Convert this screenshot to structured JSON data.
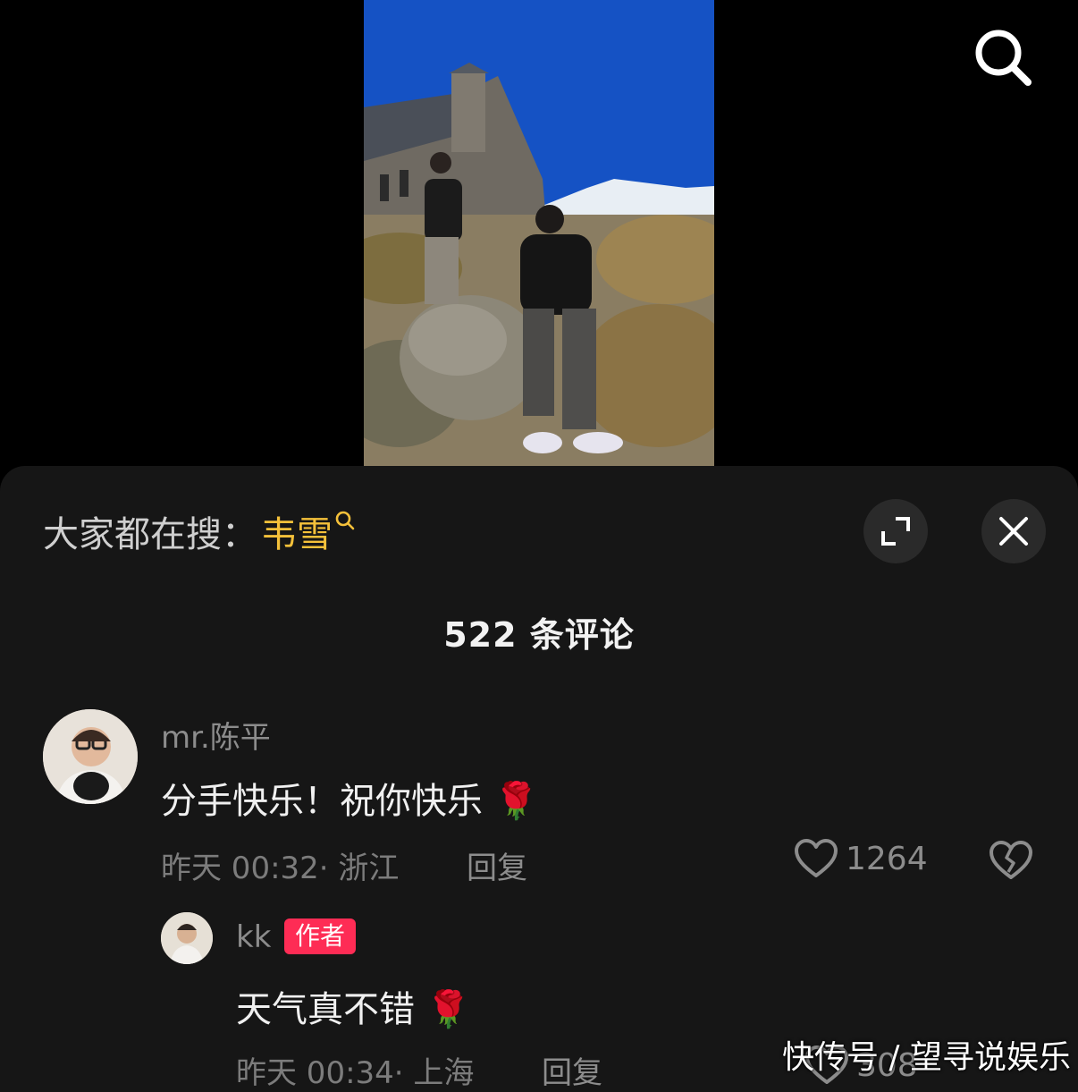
{
  "hot_search": {
    "prefix": "大家都在搜：",
    "keyword": "韦雪"
  },
  "comments_header": {
    "count_label": "522 条评论"
  },
  "comments": [
    {
      "username": "mr.陈平",
      "text": "分手快乐！祝你快乐",
      "emoji": "🌹",
      "time": "昨天 00:32",
      "location": "浙江",
      "meta_text": "昨天 00:32· 浙江",
      "reply_label": "回复",
      "like_count": "1264"
    }
  ],
  "replies": [
    {
      "username": "kk",
      "badge": "作者",
      "text": "天气真不错",
      "emoji": "🌹",
      "meta_text": "昨天 00:34· 上海",
      "reply_label": "回复",
      "like_count": "308"
    }
  ],
  "watermark": "快传号 / 望寻说娱乐",
  "colors": {
    "accent_keyword": "#f5c13a",
    "author_badge": "#fe2c55",
    "sheet_bg": "#161616"
  },
  "icons": [
    "search-icon",
    "expand-icon",
    "close-icon",
    "heart-icon",
    "broken-heart-icon"
  ]
}
